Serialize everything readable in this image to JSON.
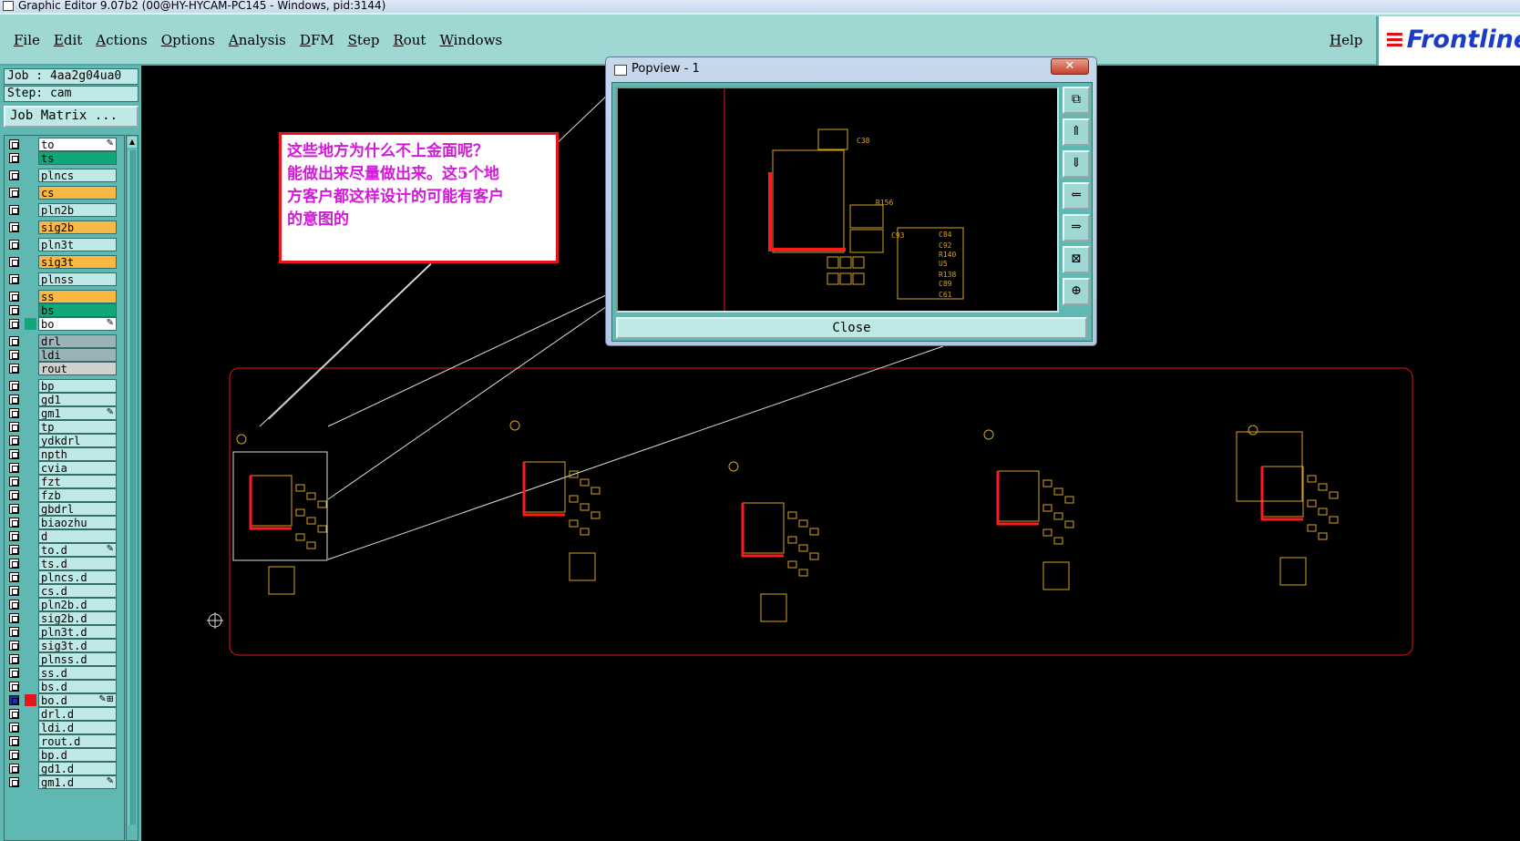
{
  "window": {
    "title": "Graphic Editor 9.07b2 (00@HY-HYCAM-PC145 - Windows, pid:3144)"
  },
  "menu": {
    "items": [
      "File",
      "Edit",
      "Actions",
      "Options",
      "Analysis",
      "DFM",
      "Step",
      "Rout",
      "Windows"
    ],
    "help": "Help",
    "logo": "Frontline"
  },
  "info": {
    "job": "Job : 4aa2g04ua0",
    "step": "Step: cam",
    "job_matrix": "Job Matrix ..."
  },
  "colors": {
    "green": "#10a878",
    "orange": "#f9b844",
    "white": "#ffffff",
    "grey": "#9ab3b8",
    "lightgrey": "#d0d0d0",
    "cyan": "#bfe9e6",
    "red": "#e8141b"
  },
  "layers": [
    {
      "name": "to",
      "bg": "white",
      "mark": "✎"
    },
    {
      "name": "ts",
      "bg": "green"
    },
    {
      "name": "plncs",
      "bg": "cyan",
      "gap": true
    },
    {
      "name": "cs",
      "bg": "orange",
      "gap": true
    },
    {
      "name": "pln2b",
      "bg": "cyan",
      "gap": true
    },
    {
      "name": "sig2b",
      "bg": "orange",
      "gap": true
    },
    {
      "name": "pln3t",
      "bg": "cyan",
      "gap": true
    },
    {
      "name": "sig3t",
      "bg": "orange",
      "gap": true
    },
    {
      "name": "plnss",
      "bg": "cyan",
      "gap": true
    },
    {
      "name": "ss",
      "bg": "orange",
      "gap": true
    },
    {
      "name": "bs",
      "bg": "green"
    },
    {
      "name": "bo",
      "bg": "white",
      "mark": "✎",
      "swatch": "green"
    },
    {
      "name": "drl",
      "bg": "grey",
      "gap": true
    },
    {
      "name": "ldi",
      "bg": "grey"
    },
    {
      "name": "rout",
      "bg": "lightgrey"
    },
    {
      "name": "bp",
      "bg": "cyan",
      "gap": true
    },
    {
      "name": "gd1",
      "bg": "cyan"
    },
    {
      "name": "gm1",
      "bg": "cyan",
      "mark": "✎"
    },
    {
      "name": "tp",
      "bg": "cyan"
    },
    {
      "name": "ydkdrl",
      "bg": "cyan"
    },
    {
      "name": "npth",
      "bg": "cyan"
    },
    {
      "name": "cvia",
      "bg": "cyan"
    },
    {
      "name": "fzt",
      "bg": "cyan"
    },
    {
      "name": "fzb",
      "bg": "cyan"
    },
    {
      "name": "gbdrl",
      "bg": "cyan"
    },
    {
      "name": "biaozhu",
      "bg": "cyan"
    },
    {
      "name": "d",
      "bg": "cyan"
    },
    {
      "name": "to.d",
      "bg": "cyan",
      "mark": "✎"
    },
    {
      "name": "ts.d",
      "bg": "cyan"
    },
    {
      "name": "plncs.d",
      "bg": "cyan"
    },
    {
      "name": "cs.d",
      "bg": "cyan"
    },
    {
      "name": "pln2b.d",
      "bg": "cyan"
    },
    {
      "name": "sig2b.d",
      "bg": "cyan"
    },
    {
      "name": "pln3t.d",
      "bg": "cyan"
    },
    {
      "name": "sig3t.d",
      "bg": "cyan"
    },
    {
      "name": "plnss.d",
      "bg": "cyan"
    },
    {
      "name": "ss.d",
      "bg": "cyan"
    },
    {
      "name": "bs.d",
      "bg": "cyan"
    },
    {
      "name": "bo.d",
      "bg": "cyan",
      "mark": "✎⊞",
      "swatch": "red",
      "checked": true
    },
    {
      "name": "drl.d",
      "bg": "cyan"
    },
    {
      "name": "ldi.d",
      "bg": "cyan"
    },
    {
      "name": "rout.d",
      "bg": "cyan"
    },
    {
      "name": "bp.d",
      "bg": "cyan"
    },
    {
      "name": "gd1.d",
      "bg": "cyan"
    },
    {
      "name": "gm1.d",
      "bg": "cyan",
      "mark": "✎"
    }
  ],
  "popview": {
    "title": "Popview - 1",
    "close_x": "✕",
    "close_label": "Close",
    "tools": [
      "⧉",
      "⇑",
      "⇓",
      "⇐",
      "⇒",
      "⊠",
      "⊕"
    ],
    "labels": [
      "C38",
      "R156",
      "C84",
      "C92",
      "R140",
      "U5",
      "R138",
      "C89",
      "C61",
      "C93"
    ]
  },
  "annotation": {
    "lines": [
      "这些地方为什么不上金面呢？",
      "能做出来尽量做出来。这5个地",
      "方客户都这样设计的可能有客户",
      "的意图的"
    ]
  }
}
